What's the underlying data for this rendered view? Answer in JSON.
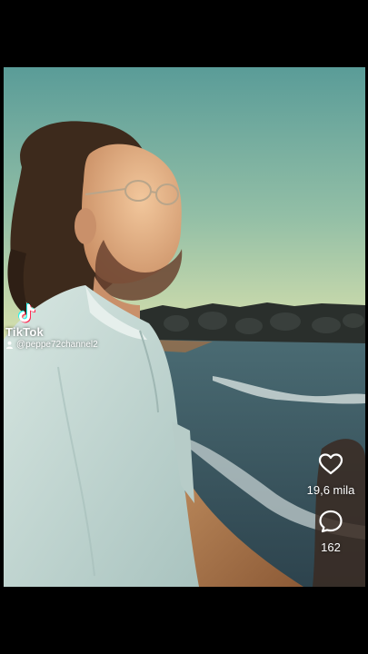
{
  "watermark": {
    "brand": "TikTok",
    "username": "@peppe72channel2",
    "logo_icon": "tiktok-logo-icon",
    "user_icon": "user-icon"
  },
  "actions": {
    "like": {
      "icon": "heart-icon",
      "count": "19,6 mila"
    },
    "comment": {
      "icon": "comment-bubble-icon",
      "count": "162"
    }
  },
  "colors": {
    "sky_top": "#5d9e9a",
    "sky_bottom": "#c7d9a6",
    "sea": "#3f5f6a",
    "shirt": "#c9dcd8",
    "background": "#000000"
  }
}
